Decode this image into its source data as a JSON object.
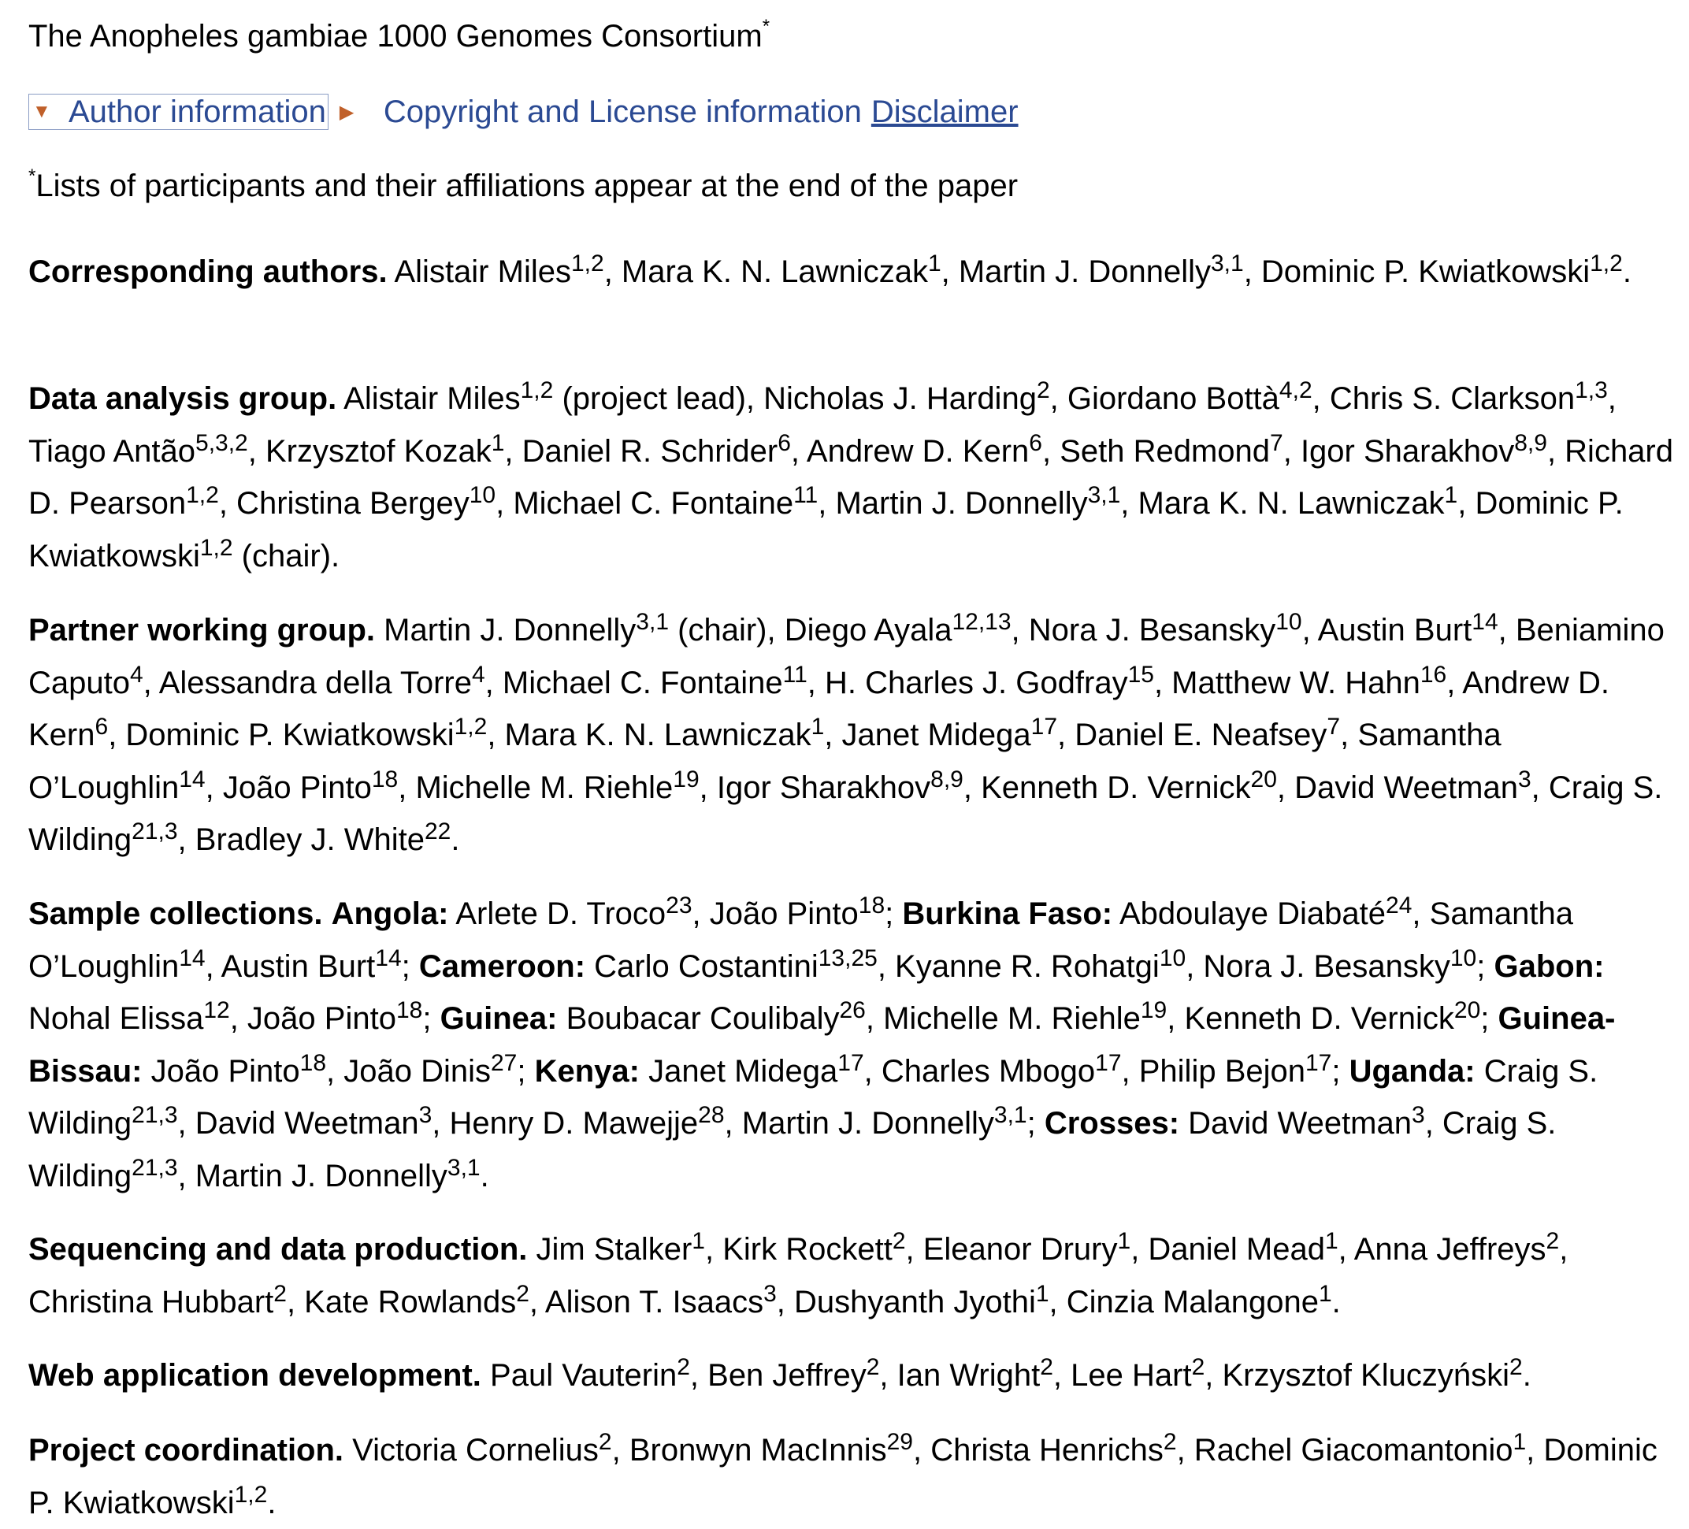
{
  "consortium": {
    "name": "The Anopheles gambiae 1000 Genomes Consortium",
    "mark": "*"
  },
  "toggles": {
    "author_info": "Author information",
    "copyright": "Copyright and License information",
    "disclaimer": "Disclaimer"
  },
  "footnote": {
    "mark": "*",
    "text": "Lists of participants and their affiliations appear at the end of the paper"
  },
  "groups": [
    {
      "id": "corresponding",
      "heading": "Corresponding authors.",
      "segments": [
        {
          "t": "Alistair Miles"
        },
        {
          "s": "1,2"
        },
        {
          "t": ", Mara K. N. Lawniczak"
        },
        {
          "s": "1"
        },
        {
          "t": ", Martin J. Donnelly"
        },
        {
          "s": "3,1"
        },
        {
          "t": ", Dominic P. Kwiatkowski"
        },
        {
          "s": "1,2"
        },
        {
          "t": "."
        }
      ]
    },
    {
      "id": "data-analysis",
      "heading": "Data analysis group.",
      "segments": [
        {
          "t": "Alistair Miles"
        },
        {
          "s": "1,2"
        },
        {
          "t": " (project lead), Nicholas J. Harding"
        },
        {
          "s": "2"
        },
        {
          "t": ", Giordano Bottà"
        },
        {
          "s": "4,2"
        },
        {
          "t": ", Chris S. Clarkson"
        },
        {
          "s": "1,3"
        },
        {
          "t": ", Tiago Antão"
        },
        {
          "s": "5,3,2"
        },
        {
          "t": ", Krzysztof Kozak"
        },
        {
          "s": "1"
        },
        {
          "t": ", Daniel R. Schrider"
        },
        {
          "s": "6"
        },
        {
          "t": ", Andrew D. Kern"
        },
        {
          "s": "6"
        },
        {
          "t": ", Seth Redmond"
        },
        {
          "s": "7"
        },
        {
          "t": ", Igor Sharakhov"
        },
        {
          "s": "8,9"
        },
        {
          "t": ", Richard D. Pearson"
        },
        {
          "s": "1,2"
        },
        {
          "t": ", Christina Bergey"
        },
        {
          "s": "10"
        },
        {
          "t": ", Michael C. Fontaine"
        },
        {
          "s": "11"
        },
        {
          "t": ", Martin J. Donnelly"
        },
        {
          "s": "3,1"
        },
        {
          "t": ", Mara K. N. Lawniczak"
        },
        {
          "s": "1"
        },
        {
          "t": ", Dominic P. Kwiatkowski"
        },
        {
          "s": "1,2"
        },
        {
          "t": " (chair)."
        }
      ]
    },
    {
      "id": "partner-working",
      "heading": "Partner working group.",
      "segments": [
        {
          "t": "Martin J. Donnelly"
        },
        {
          "s": "3,1"
        },
        {
          "t": " (chair), Diego Ayala"
        },
        {
          "s": "12,13"
        },
        {
          "t": ", Nora J. Besansky"
        },
        {
          "s": "10"
        },
        {
          "t": ", Austin Burt"
        },
        {
          "s": "14"
        },
        {
          "t": ", Beniamino Caputo"
        },
        {
          "s": "4"
        },
        {
          "t": ", Alessandra della Torre"
        },
        {
          "s": "4"
        },
        {
          "t": ", Michael C. Fontaine"
        },
        {
          "s": "11"
        },
        {
          "t": ", H. Charles J. Godfray"
        },
        {
          "s": "15"
        },
        {
          "t": ", Matthew W. Hahn"
        },
        {
          "s": "16"
        },
        {
          "t": ", Andrew D. Kern"
        },
        {
          "s": "6"
        },
        {
          "t": ", Dominic P. Kwiatkowski"
        },
        {
          "s": "1,2"
        },
        {
          "t": ", Mara K. N. Lawniczak"
        },
        {
          "s": "1"
        },
        {
          "t": ", Janet Midega"
        },
        {
          "s": "17"
        },
        {
          "t": ", Daniel E. Neafsey"
        },
        {
          "s": "7"
        },
        {
          "t": ", Samantha O’Loughlin"
        },
        {
          "s": "14"
        },
        {
          "t": ", João Pinto"
        },
        {
          "s": "18"
        },
        {
          "t": ", Michelle M. Riehle"
        },
        {
          "s": "19"
        },
        {
          "t": ", Igor Sharakhov"
        },
        {
          "s": "8,9"
        },
        {
          "t": ", Kenneth D. Vernick"
        },
        {
          "s": "20"
        },
        {
          "t": ", David Weetman"
        },
        {
          "s": "3"
        },
        {
          "t": ", Craig S. Wilding"
        },
        {
          "s": "21,3"
        },
        {
          "t": ", Bradley J. White"
        },
        {
          "s": "22"
        },
        {
          "t": "."
        }
      ]
    },
    {
      "id": "sample-collections",
      "heading": "Sample collections.",
      "segments": [
        {
          "b": "Angola:"
        },
        {
          "t": " Arlete D. Troco"
        },
        {
          "s": "23"
        },
        {
          "t": ", João Pinto"
        },
        {
          "s": "18"
        },
        {
          "t": "; "
        },
        {
          "b": "Burkina Faso:"
        },
        {
          "t": " Abdoulaye Diabaté"
        },
        {
          "s": "24"
        },
        {
          "t": ", Samantha O’Loughlin"
        },
        {
          "s": "14"
        },
        {
          "t": ", Austin Burt"
        },
        {
          "s": "14"
        },
        {
          "t": "; "
        },
        {
          "b": "Cameroon:"
        },
        {
          "t": " Carlo Costantini"
        },
        {
          "s": "13,25"
        },
        {
          "t": ", Kyanne R. Rohatgi"
        },
        {
          "s": "10"
        },
        {
          "t": ", Nora J. Besansky"
        },
        {
          "s": "10"
        },
        {
          "t": "; "
        },
        {
          "b": "Gabon:"
        },
        {
          "t": " Nohal Elissa"
        },
        {
          "s": "12"
        },
        {
          "t": ", João Pinto"
        },
        {
          "s": "18"
        },
        {
          "t": "; "
        },
        {
          "b": "Guinea:"
        },
        {
          "t": " Boubacar Coulibaly"
        },
        {
          "s": "26"
        },
        {
          "t": ", Michelle M. Riehle"
        },
        {
          "s": "19"
        },
        {
          "t": ", Kenneth D. Vernick"
        },
        {
          "s": "20"
        },
        {
          "t": "; "
        },
        {
          "b": "Guinea-Bissau:"
        },
        {
          "t": " João Pinto"
        },
        {
          "s": "18"
        },
        {
          "t": ", João Dinis"
        },
        {
          "s": "27"
        },
        {
          "t": "; "
        },
        {
          "b": "Kenya:"
        },
        {
          "t": " Janet Midega"
        },
        {
          "s": "17"
        },
        {
          "t": ", Charles Mbogo"
        },
        {
          "s": "17"
        },
        {
          "t": ", Philip Bejon"
        },
        {
          "s": "17"
        },
        {
          "t": "; "
        },
        {
          "b": "Uganda:"
        },
        {
          "t": " Craig S. Wilding"
        },
        {
          "s": "21,3"
        },
        {
          "t": ", David Weetman"
        },
        {
          "s": "3"
        },
        {
          "t": ", Henry D. Mawejje"
        },
        {
          "s": "28"
        },
        {
          "t": ", Martin J. Donnelly"
        },
        {
          "s": "3,1"
        },
        {
          "t": "; "
        },
        {
          "b": "Crosses:"
        },
        {
          "t": " David Weetman"
        },
        {
          "s": "3"
        },
        {
          "t": ", Craig S. Wilding"
        },
        {
          "s": "21,3"
        },
        {
          "t": ", Martin J. Donnelly"
        },
        {
          "s": "3,1"
        },
        {
          "t": "."
        }
      ]
    },
    {
      "id": "sequencing",
      "heading": "Sequencing and data production.",
      "segments": [
        {
          "t": "Jim Stalker"
        },
        {
          "s": "1"
        },
        {
          "t": ", Kirk Rockett"
        },
        {
          "s": "2"
        },
        {
          "t": ", Eleanor Drury"
        },
        {
          "s": "1"
        },
        {
          "t": ", Daniel Mead"
        },
        {
          "s": "1"
        },
        {
          "t": ", Anna Jeffreys"
        },
        {
          "s": "2"
        },
        {
          "t": ", Christina Hubbart"
        },
        {
          "s": "2"
        },
        {
          "t": ", Kate Rowlands"
        },
        {
          "s": "2"
        },
        {
          "t": ", Alison T. Isaacs"
        },
        {
          "s": "3"
        },
        {
          "t": ", Dushyanth Jyothi"
        },
        {
          "s": "1"
        },
        {
          "t": ", Cinzia Malangone"
        },
        {
          "s": "1"
        },
        {
          "t": "."
        }
      ]
    },
    {
      "id": "web-app",
      "heading": "Web application development.",
      "segments": [
        {
          "t": "Paul Vauterin"
        },
        {
          "s": "2"
        },
        {
          "t": ", Ben Jeffrey"
        },
        {
          "s": "2"
        },
        {
          "t": ", Ian Wright"
        },
        {
          "s": "2"
        },
        {
          "t": ", Lee Hart"
        },
        {
          "s": "2"
        },
        {
          "t": ", Krzysztof Kluczyński"
        },
        {
          "s": "2"
        },
        {
          "t": "."
        }
      ]
    },
    {
      "id": "coordination",
      "heading": "Project coordination.",
      "segments": [
        {
          "t": "Victoria Cornelius"
        },
        {
          "s": "2"
        },
        {
          "t": ", Bronwyn MacInnis"
        },
        {
          "s": "29"
        },
        {
          "t": ", Christa Henrichs"
        },
        {
          "s": "2"
        },
        {
          "t": ", Rachel Giacomantonio"
        },
        {
          "s": "1"
        },
        {
          "t": ", Dominic P. Kwiatkowski"
        },
        {
          "s": "1,2"
        },
        {
          "t": "."
        }
      ]
    }
  ]
}
